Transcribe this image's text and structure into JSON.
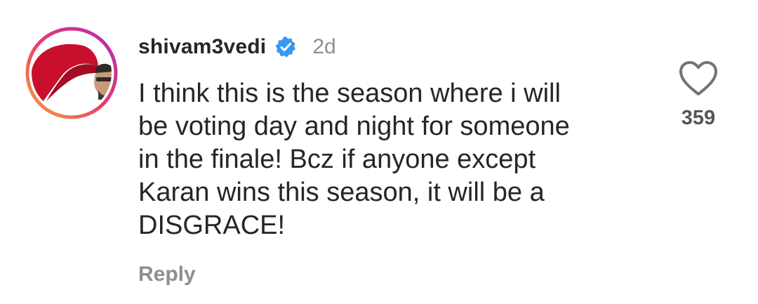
{
  "comment": {
    "username": "shivam3vedi",
    "verified": true,
    "time_ago": "2d",
    "text_lines": [
      "I think this is the season where i will",
      "be voting day and night for someone",
      "in the finale! Bcz if anyone except",
      "Karan wins this season, it will be a",
      "DISGRACE!"
    ],
    "reply_label": "Reply",
    "like_count": "359"
  },
  "colors": {
    "text": "#262626",
    "muted": "#8e8e8e",
    "verified_blue": "#3897f0",
    "avatar_red": "#c8102e"
  },
  "icons": {
    "verified": "verified-badge-icon",
    "like": "heart-outline-icon"
  }
}
